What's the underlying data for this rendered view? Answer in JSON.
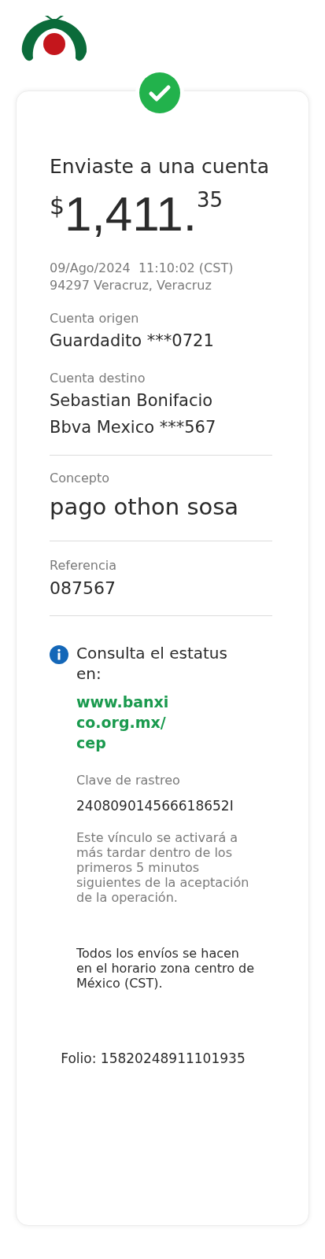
{
  "header": {
    "title": "Enviaste a una cuenta",
    "amount": {
      "currency": "$",
      "whole": "1,411.",
      "cents": "35"
    },
    "datetime": "09/Ago/2024  11:10:02 (CST)",
    "location": "94297 Veracruz, Veracruz"
  },
  "accounts": [
    {
      "label": "Cuenta origen",
      "lines": [
        "Guardadito ***0721"
      ]
    },
    {
      "label": "Cuenta destino",
      "lines": [
        "Sebastian Bonifacio",
        "Bbva Mexico ***567"
      ]
    }
  ],
  "concept": {
    "label": "Concepto",
    "value": "pago othon sosa"
  },
  "reference": {
    "label": "Referencia",
    "value": "087567"
  },
  "status": {
    "text": "Consulta el estatus en:",
    "link": "www.banxico.org.mx/cep",
    "tracking_label": "Clave de rastreo",
    "tracking_value": "240809014566618652I",
    "note": "Este vínculo se activará a más tardar dentro de los primeros 5 minutos siguientes de la aceptación de la operación.",
    "timezone_note": "Todos los envíos se hacen en el horario zona centro de México (CST)."
  },
  "folio": "Folio: 15820248911101935"
}
